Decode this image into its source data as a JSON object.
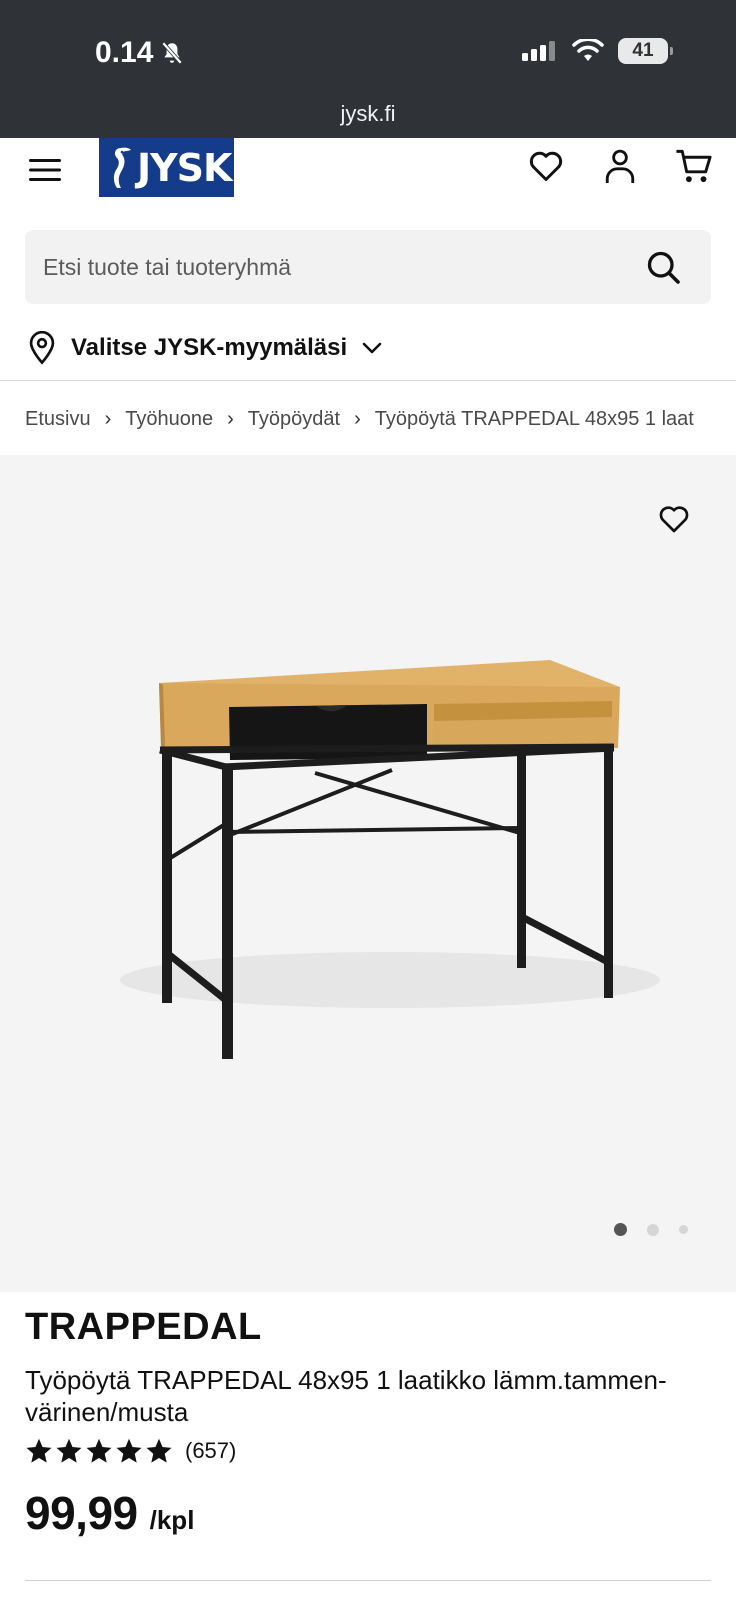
{
  "status_bar": {
    "time": "0.14",
    "battery": "41",
    "url": "jysk.fi"
  },
  "header": {
    "logo_text": "JYSK",
    "icons": [
      "menu-icon",
      "heart-icon",
      "user-icon",
      "cart-icon"
    ]
  },
  "search": {
    "placeholder": "Etsi tuote tai tuoteryhmä"
  },
  "store": {
    "label": "Valitse JYSK-myymäläsi"
  },
  "breadcrumb": [
    "Etusivu",
    "Työhuone",
    "Työpöydät",
    "Työpöytä TRAPPEDAL 48x95 1 laat"
  ],
  "product": {
    "brand": "TRAPPEDAL",
    "name": "Työpöytä TRAPPEDAL 48x95 1 laatikko lämm.tammen-värinen/musta",
    "rating_value": 5,
    "review_count": "(657)",
    "price": "99,99",
    "unit": "/kpl",
    "image_count": 3,
    "active_image": 0
  },
  "colors": {
    "status_bar": "#2f3237",
    "logo_blue": "#143c8a",
    "image_bg": "#f4f4f4"
  }
}
